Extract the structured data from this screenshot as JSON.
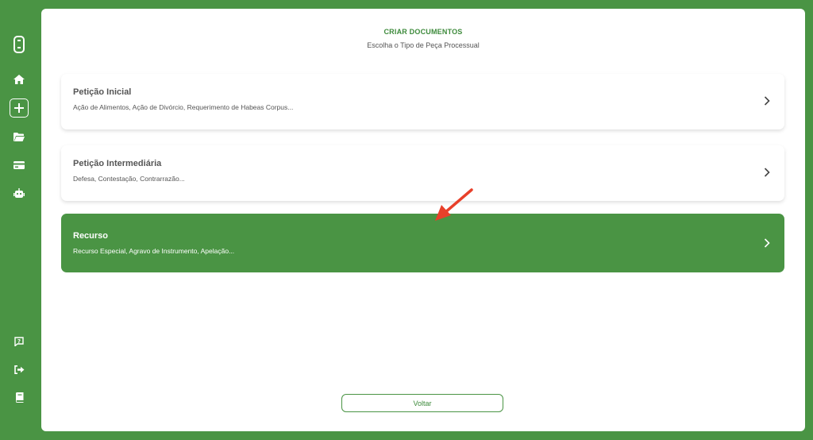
{
  "header": {
    "title": "CRIAR DOCUMENTOS",
    "subtitle": "Escolha o Tipo de Peça Processual"
  },
  "sidebar": {
    "icons": [
      "logo-icon",
      "home-icon",
      "add-icon",
      "folder-icon",
      "card-icon",
      "robot-icon",
      "help-icon",
      "logout-icon",
      "book-icon"
    ]
  },
  "options": [
    {
      "title": "Petição Inicial",
      "description": "Ação de Alimentos, Ação de Divórcio, Requerimento de Habeas Corpus..."
    },
    {
      "title": "Petição Intermediária",
      "description": "Defesa, Contestação, Contrarrazão..."
    },
    {
      "title": "Recurso",
      "description": "Recurso Especial, Agravo de Instrumento, Apelação..."
    }
  ],
  "footer": {
    "back_label": "Voltar"
  },
  "colors": {
    "brand_green": "#4a9444",
    "annotation_arrow": "#e8402a"
  }
}
